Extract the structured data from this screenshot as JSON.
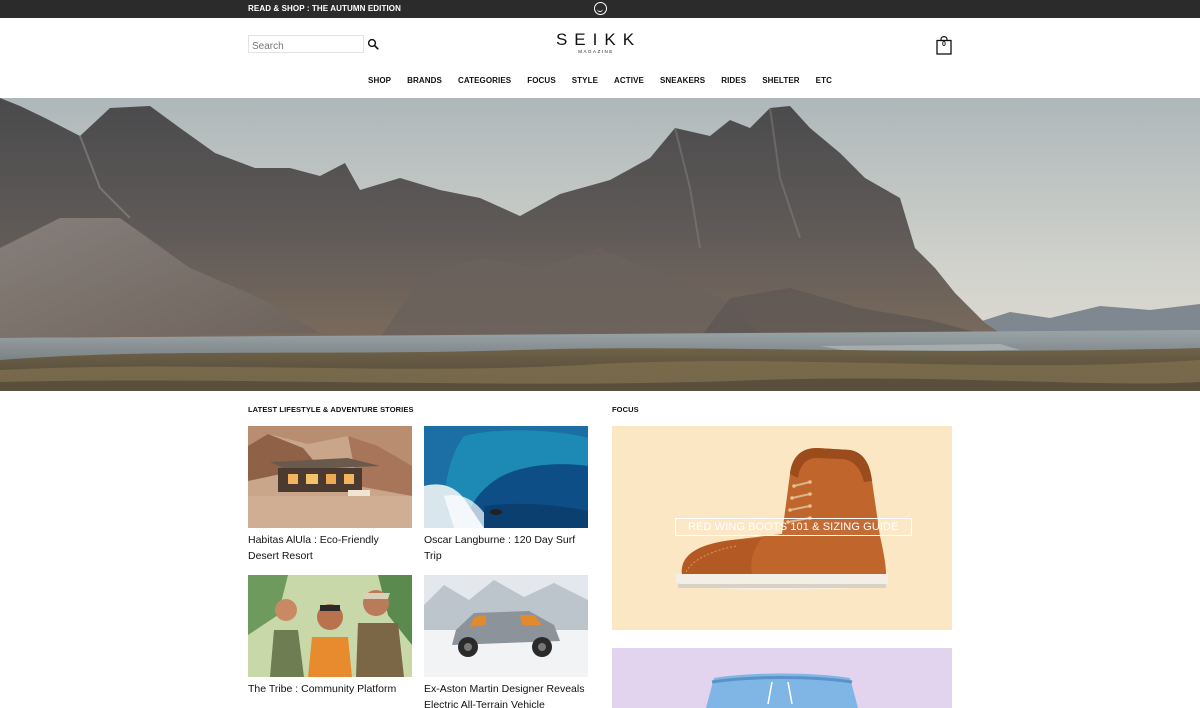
{
  "topbar": {
    "promo_text": "READ & SHOP : THE AUTUMN EDITION",
    "logo_icon": "circle-logo-icon"
  },
  "header": {
    "search": {
      "placeholder": "Search",
      "value": ""
    },
    "logo": {
      "title": "SEIKK",
      "subtitle": "MAGAZINE"
    },
    "cart": {
      "count": "0"
    }
  },
  "nav": {
    "items": [
      {
        "label": "SHOP"
      },
      {
        "label": "BRANDS"
      },
      {
        "label": "CATEGORIES"
      },
      {
        "label": "FOCUS"
      },
      {
        "label": "STYLE"
      },
      {
        "label": "ACTIVE"
      },
      {
        "label": "SNEAKERS"
      },
      {
        "label": "RIDES"
      },
      {
        "label": "SHELTER"
      },
      {
        "label": "ETC"
      }
    ]
  },
  "stories": {
    "heading": "LATEST LIFESTYLE & ADVENTURE STORIES",
    "items": [
      {
        "title": "Habitas AlUla : Eco-Friendly Desert Resort"
      },
      {
        "title": "Oscar Langburne : 120 Day Surf Trip"
      },
      {
        "title": "The Tribe : Community Platform"
      },
      {
        "title": "Ex-Aston Martin Designer Reveals Electric All-Terrain Vehicle"
      }
    ]
  },
  "focus": {
    "heading": "FOCUS",
    "feature": {
      "title": "RED WING BOOTS 101 & SIZING GUIDE"
    }
  },
  "colors": {
    "topbar_bg": "#2b2b2b",
    "focus_card_bg": "#fce7c4",
    "focus_card_2_bg": "#e2d3ee",
    "boot_leather": "#c0652c"
  }
}
